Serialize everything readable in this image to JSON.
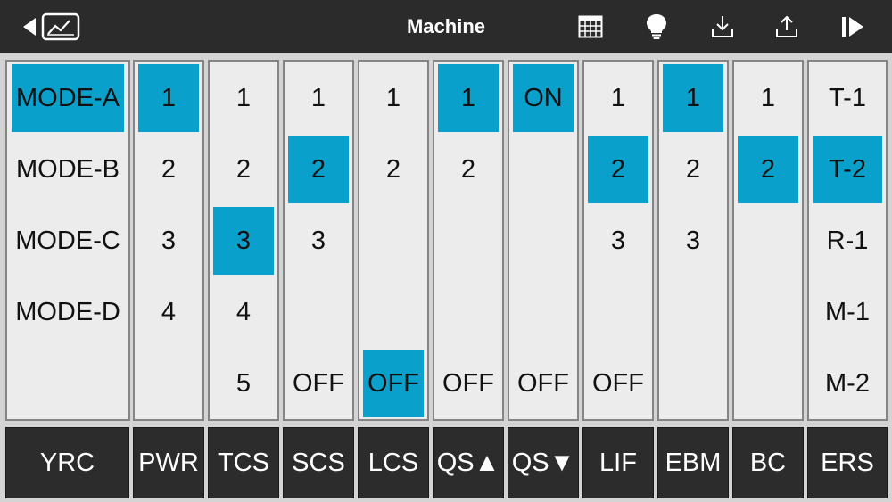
{
  "header": {
    "title": "Machine",
    "icons": [
      "back-chart-icon",
      "grid-icon",
      "lightbulb-icon",
      "import-icon",
      "export-icon",
      "play-next-icon"
    ]
  },
  "colors": {
    "topbar": "#2b2b2b",
    "selected": "#0aa0cc",
    "column_bg": "#ececec",
    "button_bg": "#2c2c2c"
  },
  "columns": [
    {
      "id": "yrc",
      "options": [
        "MODE-A",
        "MODE-B",
        "MODE-C",
        "MODE-D",
        ""
      ],
      "selected": 0
    },
    {
      "id": "pwr",
      "options": [
        "1",
        "2",
        "3",
        "4",
        ""
      ],
      "selected": 0
    },
    {
      "id": "tcs",
      "options": [
        "1",
        "2",
        "3",
        "4",
        "5"
      ],
      "selected": 2
    },
    {
      "id": "scs",
      "options": [
        "1",
        "2",
        "3",
        "",
        "OFF"
      ],
      "selected": 1
    },
    {
      "id": "lcs",
      "options": [
        "1",
        "2",
        "",
        "",
        "OFF"
      ],
      "selected": 4
    },
    {
      "id": "qs-up",
      "options": [
        "1",
        "2",
        "",
        "",
        "OFF"
      ],
      "selected": 0
    },
    {
      "id": "qs-down",
      "options": [
        "ON",
        "",
        "",
        "",
        "OFF"
      ],
      "selected": 0
    },
    {
      "id": "lif",
      "options": [
        "1",
        "2",
        "3",
        "",
        "OFF"
      ],
      "selected": 1
    },
    {
      "id": "ebm",
      "options": [
        "1",
        "2",
        "3",
        "",
        ""
      ],
      "selected": 0
    },
    {
      "id": "bc",
      "options": [
        "1",
        "2",
        "",
        "",
        ""
      ],
      "selected": 1
    },
    {
      "id": "ers",
      "options": [
        "T-1",
        "T-2",
        "R-1",
        "M-1",
        "M-2"
      ],
      "selected": 1
    }
  ],
  "buttons": [
    "YRC",
    "PWR",
    "TCS",
    "SCS",
    "LCS",
    "QS▲",
    "QS▼",
    "LIF",
    "EBM",
    "BC",
    "ERS"
  ]
}
